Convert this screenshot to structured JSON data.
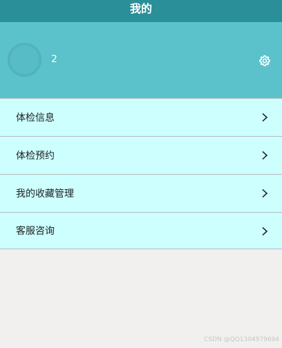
{
  "header": {
    "title": "我的"
  },
  "profile": {
    "username": "2",
    "settings_icon": "gear-icon"
  },
  "menu": {
    "items": [
      {
        "label": "体检信息",
        "icon": "chevron-right-icon"
      },
      {
        "label": "体检预约",
        "icon": "chevron-right-icon"
      },
      {
        "label": "我的收藏管理",
        "icon": "chevron-right-icon"
      },
      {
        "label": "客服咨询",
        "icon": "chevron-right-icon"
      }
    ]
  },
  "watermark": {
    "text": "CSDN @QQ1304979694"
  },
  "colors": {
    "header_bg": "#2a8f98",
    "profile_bg": "#5bc1cb",
    "menu_bg": "#ccfffe",
    "page_bg": "#f1f0ef"
  }
}
